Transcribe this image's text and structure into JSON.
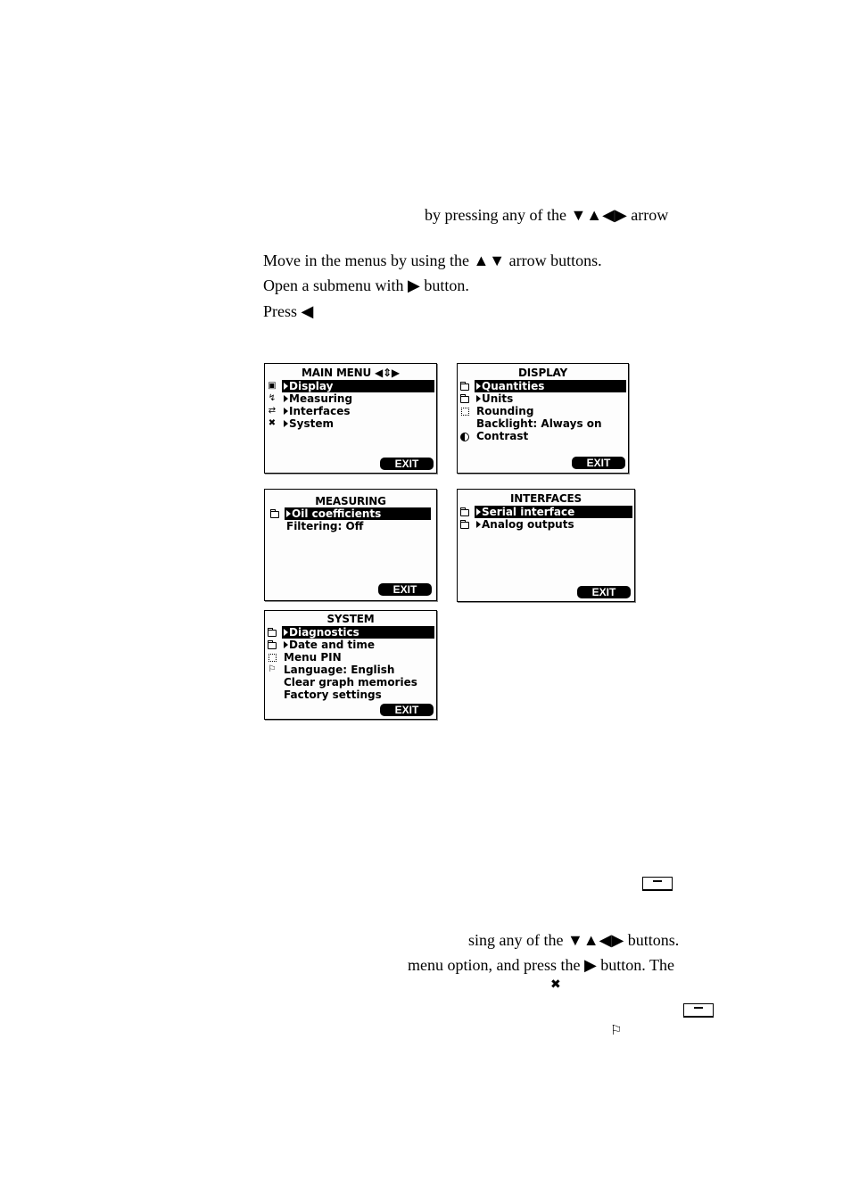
{
  "text_lines": {
    "line1": "by pressing any of the ▼▲◀▶ arrow",
    "line2": "Move in the menus by using the ▲▼ arrow buttons.",
    "line3": "Open a submenu with ▶ button.",
    "line4": "Press ◀",
    "line5": "sing any of the ▼▲◀▶ buttons.",
    "line6": "menu option, and press the ▶ button. The"
  },
  "inline_icons": {
    "wrench": "wrench-icon",
    "flag": "flag-icon",
    "key_button": "function-key-icon"
  },
  "screens": {
    "main_menu": {
      "title": "MAIN MENU ◀⇕▶",
      "items": [
        {
          "icon": "display-icon",
          "label": "Display",
          "submenu": true,
          "selected": true
        },
        {
          "icon": "measuring-icon",
          "label": "Measuring",
          "submenu": true,
          "selected": false
        },
        {
          "icon": "interfaces-icon",
          "label": "Interfaces",
          "submenu": true,
          "selected": false
        },
        {
          "icon": "wrench-icon",
          "label": "System",
          "submenu": true,
          "selected": false
        }
      ],
      "exit": "EXIT"
    },
    "display": {
      "title": "DISPLAY",
      "items": [
        {
          "icon": "folder-icon",
          "label": "Quantities",
          "submenu": true,
          "selected": true
        },
        {
          "icon": "folder-icon",
          "label": "Units",
          "submenu": true,
          "selected": false
        },
        {
          "icon": "dotted-box-icon",
          "label": "Rounding",
          "submenu": false,
          "selected": false
        },
        {
          "icon": "",
          "label": "Backlight: Always on",
          "submenu": false,
          "selected": false
        },
        {
          "icon": "contrast-icon",
          "label": "Contrast",
          "submenu": false,
          "selected": false
        }
      ],
      "exit": "EXIT"
    },
    "measuring": {
      "title": "MEASURING",
      "items": [
        {
          "icon": "folder-icon",
          "label": "Oil coefficients",
          "submenu": true,
          "selected": true
        },
        {
          "icon": "",
          "label": "Filtering: Off",
          "submenu": false,
          "selected": false
        }
      ],
      "exit": "EXIT"
    },
    "interfaces": {
      "title": "INTERFACES",
      "items": [
        {
          "icon": "folder-icon",
          "label": "Serial interface",
          "submenu": true,
          "selected": true
        },
        {
          "icon": "folder-icon",
          "label": "Analog outputs",
          "submenu": true,
          "selected": false
        }
      ],
      "exit": "EXIT"
    },
    "system": {
      "title": "SYSTEM",
      "items": [
        {
          "icon": "folder-icon",
          "label": "Diagnostics",
          "submenu": true,
          "selected": true
        },
        {
          "icon": "folder-icon",
          "label": "Date and time",
          "submenu": true,
          "selected": false
        },
        {
          "icon": "dotted-box-icon",
          "label": "Menu PIN",
          "submenu": false,
          "selected": false
        },
        {
          "icon": "flag-icon",
          "label": "Language: English",
          "submenu": false,
          "selected": false
        },
        {
          "icon": "",
          "label": "Clear graph memories",
          "submenu": false,
          "selected": false
        },
        {
          "icon": "",
          "label": "Factory settings",
          "submenu": false,
          "selected": false
        }
      ],
      "exit": "EXIT"
    }
  }
}
